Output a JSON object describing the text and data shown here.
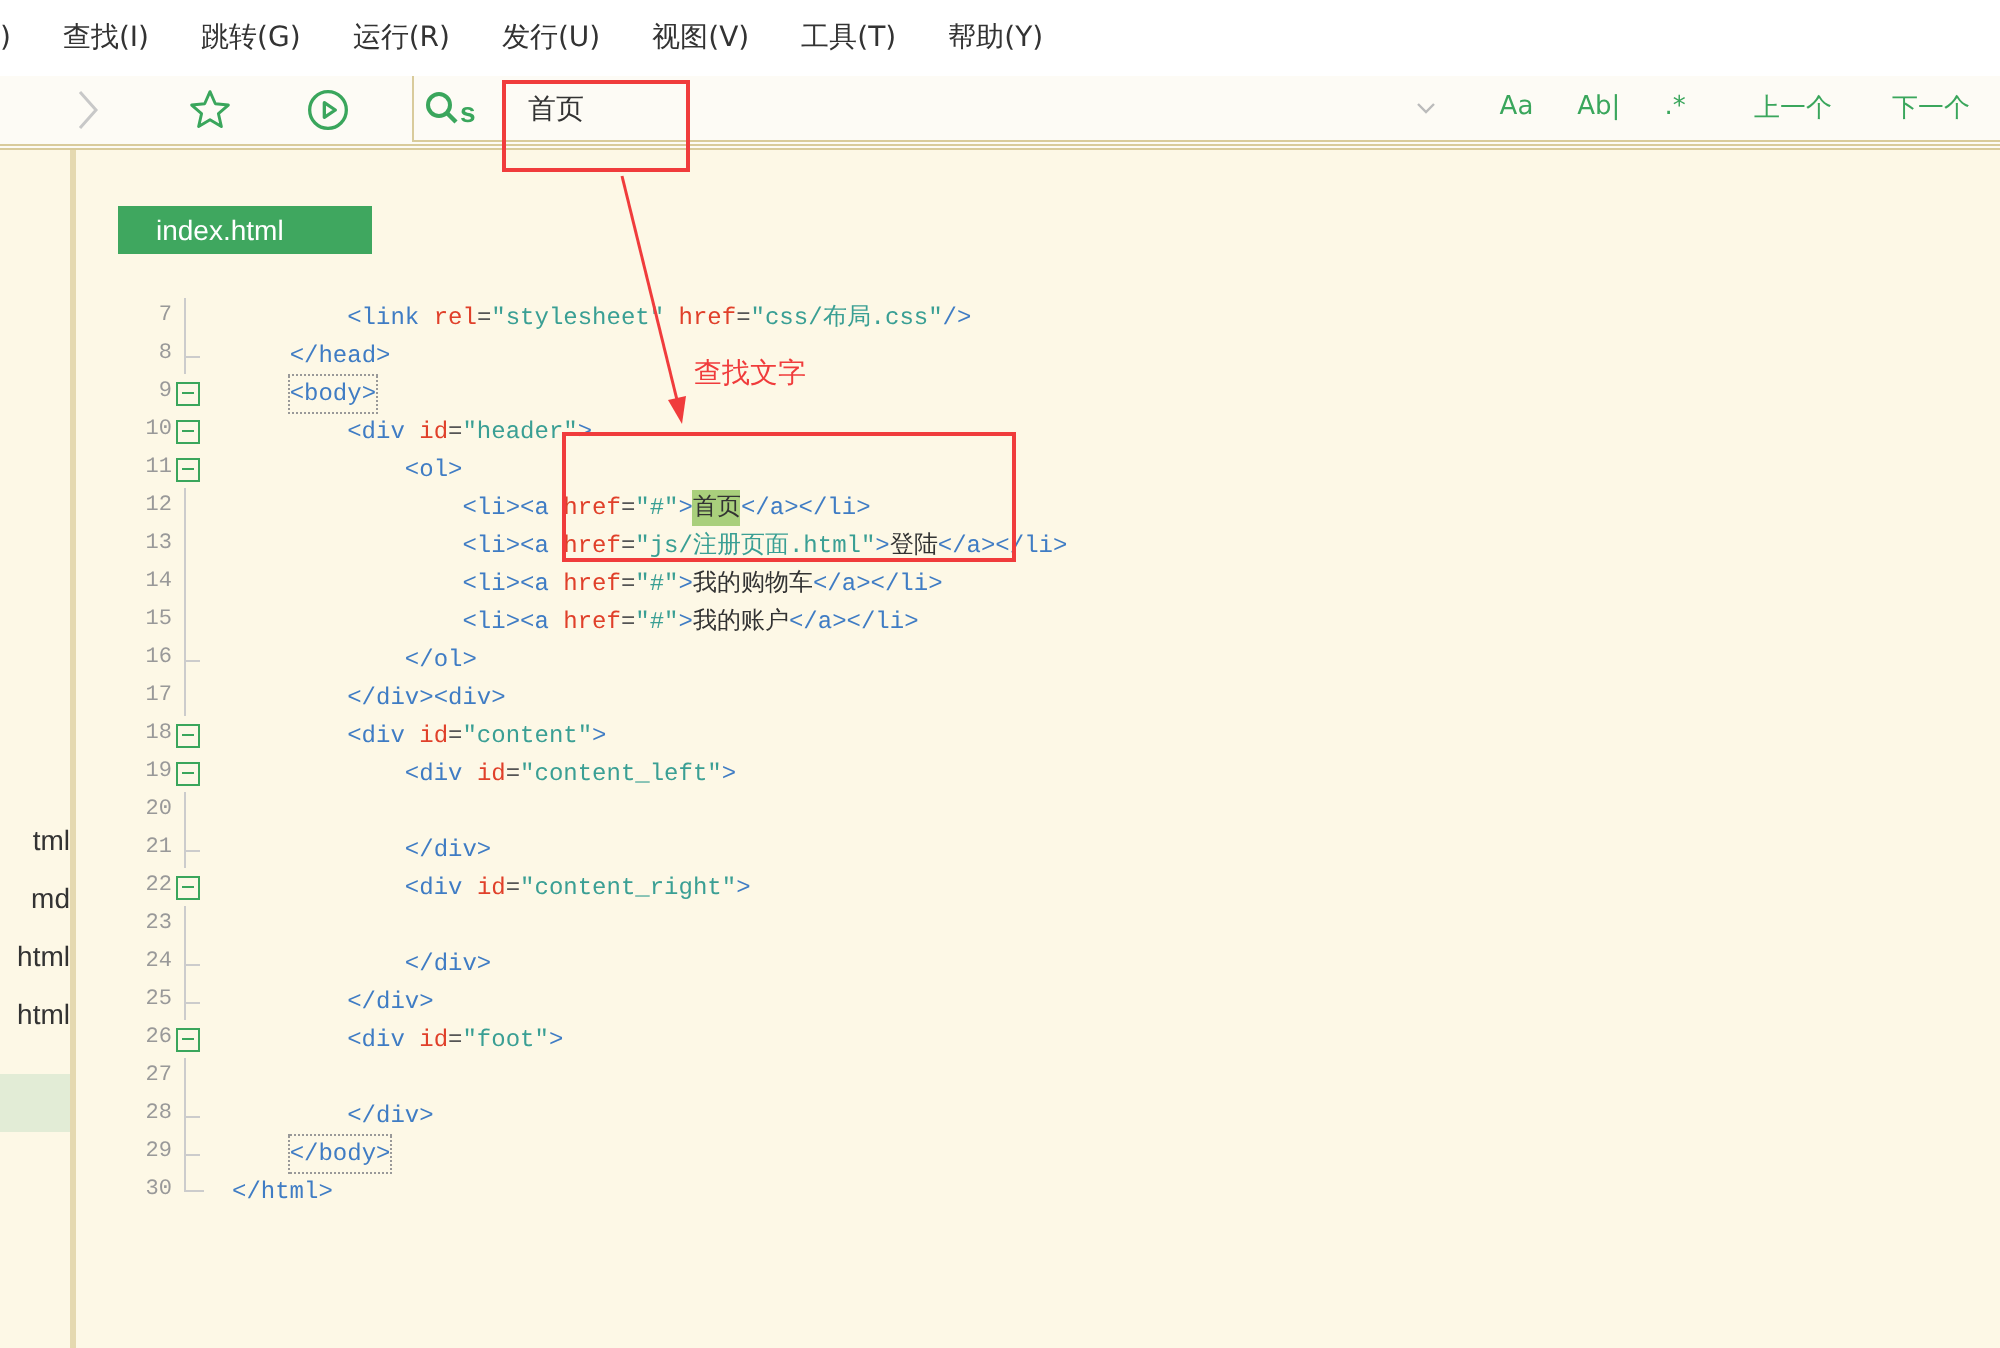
{
  "menu": [
    ")",
    "查找(I)",
    "跳转(G)",
    "运行(R)",
    "发行(U)",
    "视图(V)",
    "工具(T)",
    "帮助(Y)"
  ],
  "toolbar": {
    "search": {
      "prefix": "s",
      "value": "首页"
    },
    "options": [
      "Aa",
      "Ab|",
      ".*"
    ],
    "prev": "上一个",
    "next": "下一个"
  },
  "sidebar": {
    "items": [
      {
        "label": "tml",
        "selected": false
      },
      {
        "label": "md",
        "selected": false
      },
      {
        "label": "html",
        "selected": false
      },
      {
        "label": "html",
        "selected": false
      },
      {
        "selected": true
      }
    ]
  },
  "tab": {
    "label": "index.html",
    "selected": true
  },
  "lines": [
    {
      "number": "7",
      "kind": "plain",
      "tokens": [
        {
          "kind": "tag",
          "text": "        <link"
        },
        {
          "kind": "attr",
          "text": " rel"
        },
        {
          "kind": "punct",
          "text": "="
        },
        {
          "kind": "string",
          "text": "\"stylesheet\""
        },
        {
          "kind": "attr",
          "text": " href"
        },
        {
          "kind": "punct",
          "text": "="
        },
        {
          "kind": "string",
          "text": "\"css/布局.css\""
        },
        {
          "kind": "tag",
          "text": "/>"
        }
      ]
    },
    {
      "number": "8",
      "kind": "end",
      "tokens": [
        {
          "kind": "tag",
          "text": "    </head>"
        }
      ]
    },
    {
      "number": "9",
      "kind": "fold",
      "expanded": true,
      "tokens": [
        {
          "kind": "bracket",
          "text": "    <body>"
        }
      ]
    },
    {
      "number": "10",
      "kind": "fold",
      "expanded": true,
      "tokens": [
        {
          "kind": "tag",
          "text": "        <div"
        },
        {
          "kind": "attr",
          "text": " id"
        },
        {
          "kind": "punct",
          "text": "="
        },
        {
          "kind": "string",
          "text": "\"header\""
        },
        {
          "kind": "tag",
          "text": ">"
        }
      ]
    },
    {
      "number": "11",
      "kind": "fold",
      "expanded": true,
      "tokens": [
        {
          "kind": "tag",
          "text": "            <ol>"
        }
      ]
    },
    {
      "number": "12",
      "kind": "plain",
      "tokens": [
        {
          "kind": "tag",
          "text": "                <li><a"
        },
        {
          "kind": "attr",
          "text": " href"
        },
        {
          "kind": "punct",
          "text": "="
        },
        {
          "kind": "string",
          "text": "\"#\""
        },
        {
          "kind": "tag",
          "text": ">"
        },
        {
          "kind": "match",
          "text": "首页"
        },
        {
          "kind": "tag",
          "text": "</a></li>"
        }
      ]
    },
    {
      "number": "13",
      "kind": "plain",
      "tokens": [
        {
          "kind": "tag",
          "text": "                <li><a"
        },
        {
          "kind": "attr",
          "text": " href"
        },
        {
          "kind": "punct",
          "text": "="
        },
        {
          "kind": "string",
          "text": "\"js/注册页面.html\""
        },
        {
          "kind": "tag",
          "text": ">"
        },
        {
          "kind": "text",
          "text": "登陆"
        },
        {
          "kind": "tag",
          "text": "</a></li>"
        }
      ]
    },
    {
      "number": "14",
      "kind": "plain",
      "tokens": [
        {
          "kind": "tag",
          "text": "                <li><a"
        },
        {
          "kind": "attr",
          "text": " href"
        },
        {
          "kind": "punct",
          "text": "="
        },
        {
          "kind": "string",
          "text": "\"#\""
        },
        {
          "kind": "tag",
          "text": ">"
        },
        {
          "kind": "text",
          "text": "我的购物车"
        },
        {
          "kind": "tag",
          "text": "</a></li>"
        }
      ]
    },
    {
      "number": "15",
      "kind": "plain",
      "tokens": [
        {
          "kind": "tag",
          "text": "                <li><a"
        },
        {
          "kind": "attr",
          "text": " href"
        },
        {
          "kind": "punct",
          "text": "="
        },
        {
          "kind": "string",
          "text": "\"#\""
        },
        {
          "kind": "tag",
          "text": ">"
        },
        {
          "kind": "text",
          "text": "我的账户"
        },
        {
          "kind": "tag",
          "text": "</a></li>"
        }
      ]
    },
    {
      "number": "16",
      "kind": "end",
      "tokens": [
        {
          "kind": "tag",
          "text": "            </ol>"
        }
      ]
    },
    {
      "number": "17",
      "kind": "plain",
      "tokens": [
        {
          "kind": "tag",
          "text": "        </div><div>"
        }
      ]
    },
    {
      "number": "18",
      "kind": "fold",
      "expanded": true,
      "tokens": [
        {
          "kind": "tag",
          "text": "        <div"
        },
        {
          "kind": "attr",
          "text": " id"
        },
        {
          "kind": "punct",
          "text": "="
        },
        {
          "kind": "string",
          "text": "\"content\""
        },
        {
          "kind": "tag",
          "text": ">"
        }
      ]
    },
    {
      "number": "19",
      "kind": "fold",
      "expanded": true,
      "tokens": [
        {
          "kind": "tag",
          "text": "            <div"
        },
        {
          "kind": "attr",
          "text": " id"
        },
        {
          "kind": "punct",
          "text": "="
        },
        {
          "kind": "string",
          "text": "\"content_left\""
        },
        {
          "kind": "tag",
          "text": ">"
        }
      ]
    },
    {
      "number": "20",
      "kind": "plain"
    },
    {
      "number": "21",
      "kind": "end",
      "tokens": [
        {
          "kind": "tag",
          "text": "            </div>"
        }
      ]
    },
    {
      "number": "22",
      "kind": "fold",
      "expanded": true,
      "tokens": [
        {
          "kind": "tag",
          "text": "            <div"
        },
        {
          "kind": "attr",
          "text": " id"
        },
        {
          "kind": "punct",
          "text": "="
        },
        {
          "kind": "string",
          "text": "\"content_right\""
        },
        {
          "kind": "tag",
          "text": ">"
        }
      ]
    },
    {
      "number": "23",
      "kind": "plain"
    },
    {
      "number": "24",
      "kind": "end",
      "tokens": [
        {
          "kind": "tag",
          "text": "            </div>"
        }
      ]
    },
    {
      "number": "25",
      "kind": "end",
      "tokens": [
        {
          "kind": "tag",
          "text": "        </div>"
        }
      ]
    },
    {
      "number": "26",
      "kind": "fold",
      "expanded": true,
      "tokens": [
        {
          "kind": "tag",
          "text": "        <div"
        },
        {
          "kind": "attr",
          "text": " id"
        },
        {
          "kind": "punct",
          "text": "="
        },
        {
          "kind": "string",
          "text": "\"foot\""
        },
        {
          "kind": "tag",
          "text": ">"
        }
      ]
    },
    {
      "number": "27",
      "kind": "plain"
    },
    {
      "number": "28",
      "kind": "end",
      "tokens": [
        {
          "kind": "tag",
          "text": "        </div>"
        }
      ]
    },
    {
      "number": "29",
      "kind": "end",
      "tokens": [
        {
          "kind": "bracket",
          "text": "    </body>"
        }
      ]
    },
    {
      "number": "30",
      "kind": "last",
      "tokens": [
        {
          "kind": "tag",
          "text": "</html>"
        }
      ]
    }
  ],
  "annotation": {
    "label": "查找文字"
  }
}
